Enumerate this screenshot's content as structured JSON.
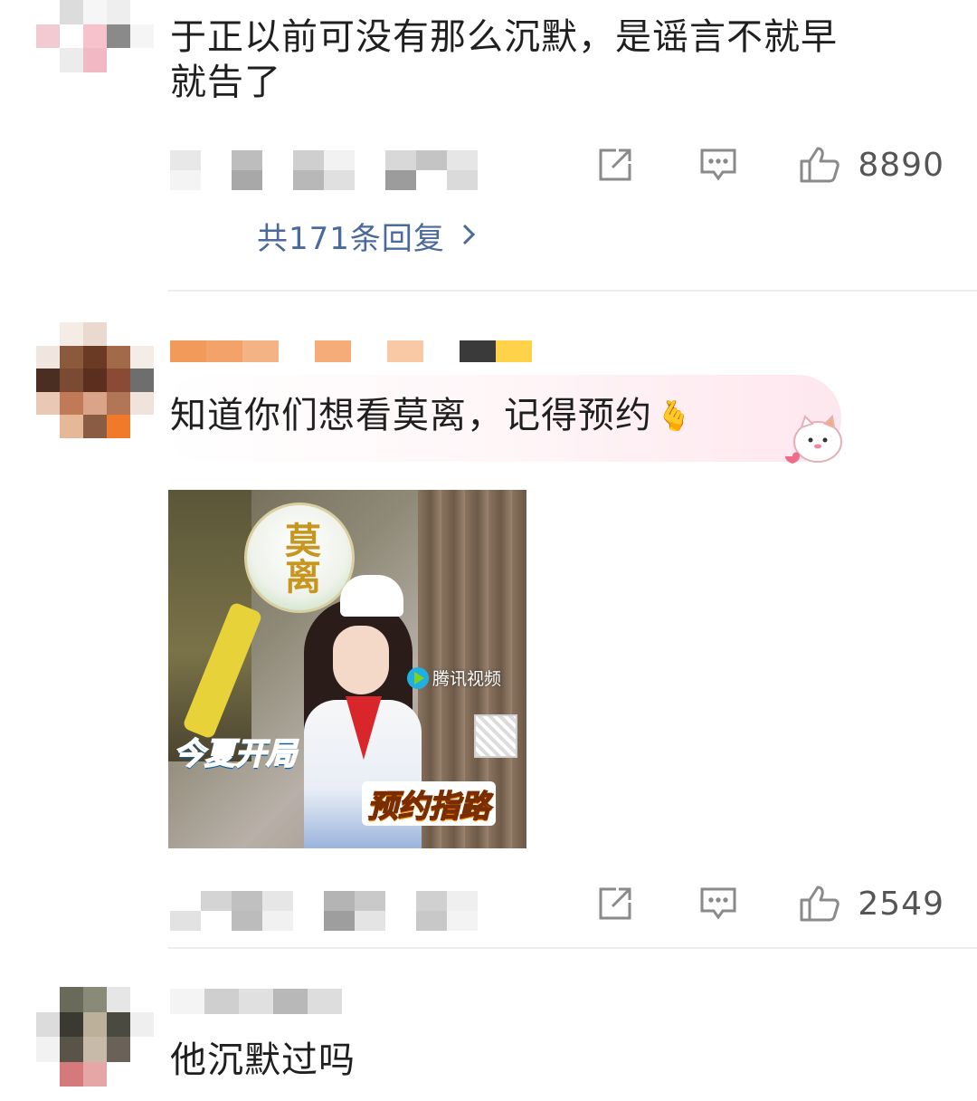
{
  "comments": [
    {
      "text": "于正以前可没有那么沉默，是谣言不就早就告了",
      "text_line1": "于正以前可没有那么沉默，是谣言不就早",
      "text_line2": "就告了",
      "like_count": "8890",
      "replies_label": "共171条回复"
    },
    {
      "text": "知道你们想看莫离，记得预约",
      "emoji": "🫰",
      "media": {
        "sign_text": "莫离",
        "watermark": "腾讯视频",
        "banner_left": "今夏开局",
        "banner_right": "预约指路"
      },
      "like_count": "2549"
    },
    {
      "text": "他沉默过吗"
    }
  ],
  "colors": {
    "reply_link": "#4a6a9c",
    "divider": "#ececec",
    "icon": "#8a8a8a"
  },
  "icons": [
    "share-icon",
    "comment-icon",
    "like-icon",
    "chevron-right-icon",
    "cat-sticker-icon"
  ]
}
